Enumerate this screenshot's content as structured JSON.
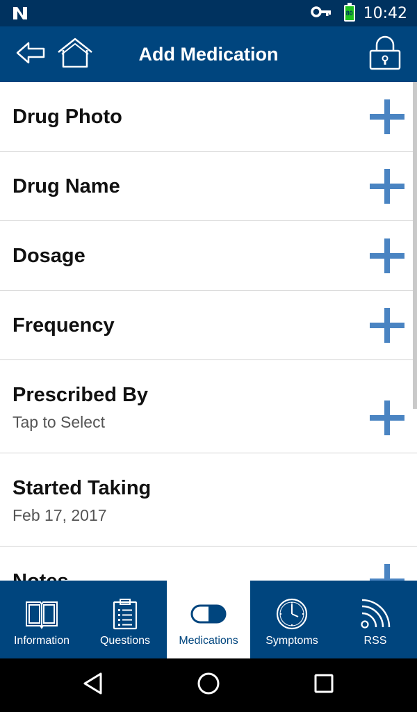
{
  "status_bar": {
    "time": "10:42",
    "battery_level": "80",
    "battery_color": "#1ec21e",
    "icons": [
      "notification-n-icon",
      "vpn-key-icon",
      "battery-icon"
    ]
  },
  "app_bar": {
    "title": "Add Medication",
    "background": "#00457e",
    "buttons": [
      "back-arrow-icon",
      "home-icon",
      "lock-icon"
    ]
  },
  "form": {
    "rows": [
      {
        "label": "Drug Photo",
        "has_add": true
      },
      {
        "label": "Drug Name",
        "has_add": true
      },
      {
        "label": "Dosage",
        "has_add": true
      },
      {
        "label": "Frequency",
        "has_add": true
      },
      {
        "label": "Prescribed By",
        "value": "Tap to Select",
        "has_add": true
      },
      {
        "label": "Started Taking",
        "value": "Feb 17, 2017",
        "has_add": false
      },
      {
        "label": "Notes",
        "has_add": true
      }
    ],
    "accent": "#4a84c2"
  },
  "tabs": [
    {
      "label": "Information",
      "icon": "book-icon",
      "active": false
    },
    {
      "label": "Questions",
      "icon": "clipboard-icon",
      "active": false
    },
    {
      "label": "Medications",
      "icon": "pill-icon",
      "active": true
    },
    {
      "label": "Symptoms",
      "icon": "clock-icon",
      "active": false
    },
    {
      "label": "RSS",
      "icon": "rss-icon",
      "active": false
    }
  ],
  "nav_bar": {
    "buttons": [
      "back-triangle-icon",
      "home-circle-icon",
      "recents-square-icon"
    ]
  }
}
